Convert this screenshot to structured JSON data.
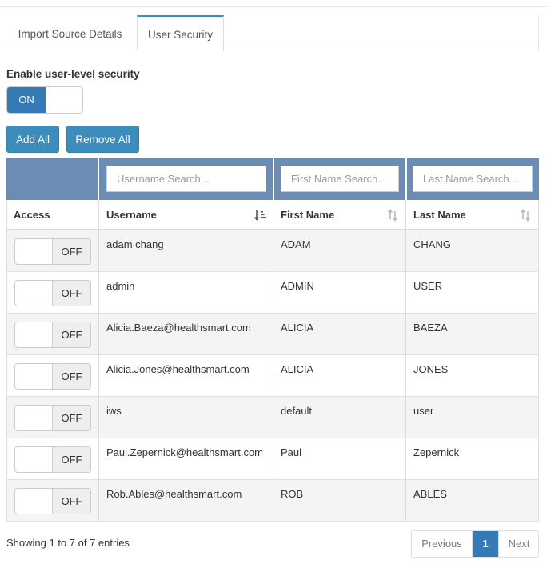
{
  "tabs": [
    {
      "label": "Import Source Details"
    },
    {
      "label": "User Security"
    }
  ],
  "security": {
    "enable_label": "Enable user-level security",
    "toggle_state": "ON"
  },
  "actions": {
    "add_all": "Add All",
    "remove_all": "Remove All"
  },
  "filters": {
    "username_placeholder": "Username Search...",
    "first_name_placeholder": "First Name Search...",
    "last_name_placeholder": "Last Name Search..."
  },
  "columns": {
    "access": "Access",
    "username": "Username",
    "first_name": "First Name",
    "last_name": "Last Name"
  },
  "sort": {
    "username": "sorted-ascending",
    "first_name": "sortable",
    "last_name": "sortable"
  },
  "rows": [
    {
      "access": "OFF",
      "username": "adam chang",
      "first_name": "ADAM",
      "last_name": "CHANG"
    },
    {
      "access": "OFF",
      "username": "admin",
      "first_name": "ADMIN",
      "last_name": "USER"
    },
    {
      "access": "OFF",
      "username": "Alicia.Baeza@healthsmart.com",
      "first_name": "ALICIA",
      "last_name": "BAEZA"
    },
    {
      "access": "OFF",
      "username": "Alicia.Jones@healthsmart.com",
      "first_name": "ALICIA",
      "last_name": "JONES"
    },
    {
      "access": "OFF",
      "username": "iws",
      "first_name": "default",
      "last_name": "user"
    },
    {
      "access": "OFF",
      "username": "Paul.Zepernick@healthsmart.com",
      "first_name": "Paul",
      "last_name": "Zepernick"
    },
    {
      "access": "OFF",
      "username": "Rob.Ables@healthsmart.com",
      "first_name": "ROB",
      "last_name": "ABLES"
    }
  ],
  "footer": {
    "info": "Showing 1 to 7 of 7 entries",
    "previous": "Previous",
    "current_page": "1",
    "next": "Next"
  },
  "colors": {
    "accent": "#3c8dbc",
    "toggle_on": "#337ab7",
    "filter_bar": "#6c8db3"
  }
}
